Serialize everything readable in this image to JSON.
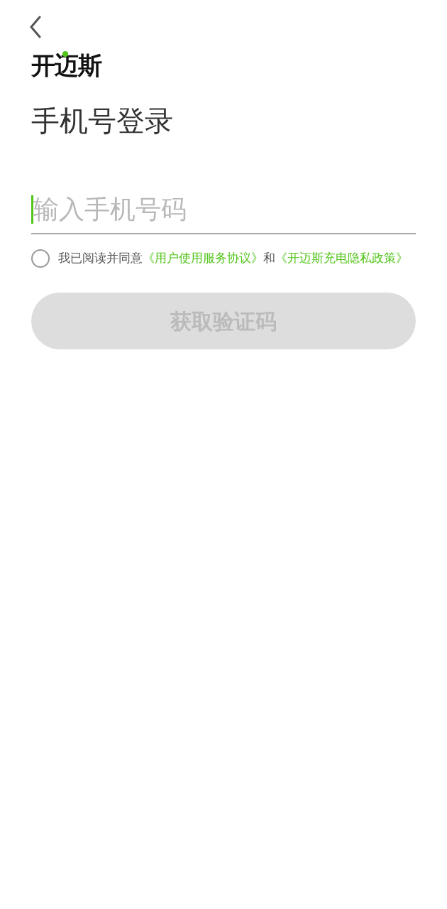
{
  "logo": {
    "text": "开迈斯"
  },
  "title": "手机号登录",
  "phone_field": {
    "placeholder": "输入手机号码",
    "focused": true
  },
  "agreement": {
    "checked": false,
    "segments": [
      {
        "kind": "text",
        "text": "我已阅读并同意"
      },
      {
        "kind": "link",
        "text": "《用户使用服务协议》"
      },
      {
        "kind": "text",
        "text": "和"
      },
      {
        "kind": "link",
        "text": "《开迈斯充电隐私政策》"
      }
    ]
  },
  "submit_button": {
    "label": "获取验证码",
    "disabled": true
  }
}
